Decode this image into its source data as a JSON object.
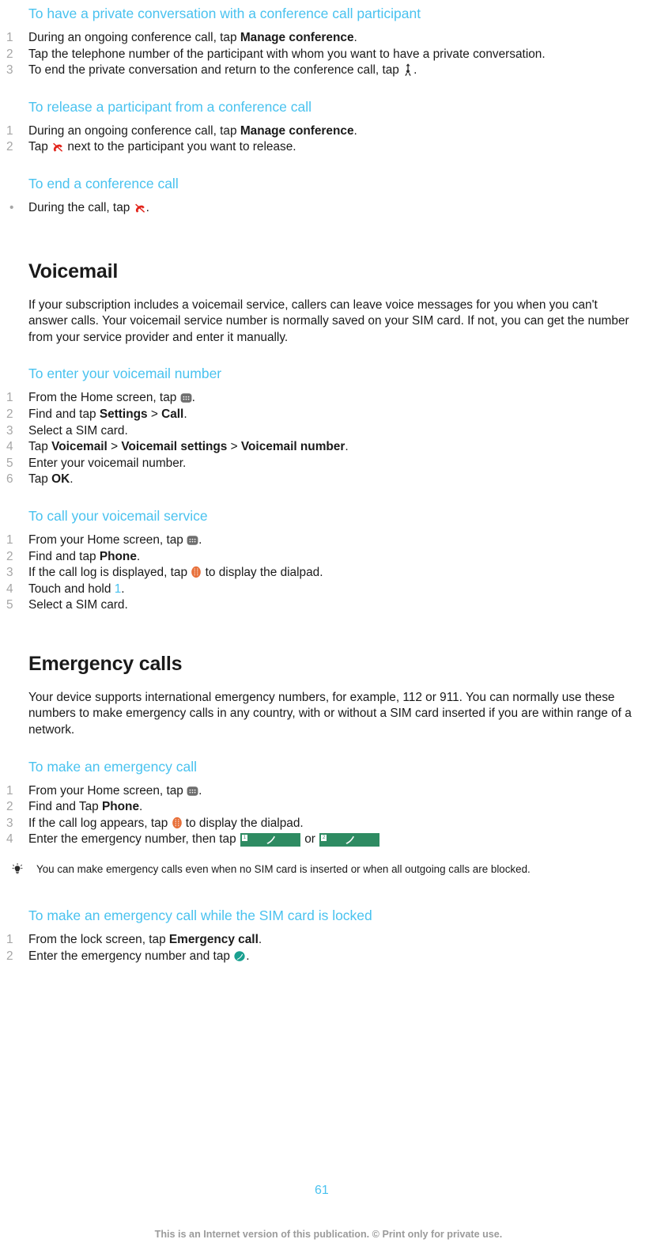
{
  "page": {
    "number": "61",
    "footer_note": "This is an Internet version of this publication. © Print only for private use."
  },
  "sections": [
    {
      "heading": "To have a private conversation with a conference call participant",
      "steps": [
        {
          "num": "1",
          "pre": "During an ongoing conference call, tap ",
          "bold": "Manage conference",
          "post": "."
        },
        {
          "num": "2",
          "pre": "Tap the telephone number of the participant with whom you want to have a private conversation.",
          "bold": "",
          "post": ""
        },
        {
          "num": "3",
          "pre": "To end the private conversation and return to the conference call, tap ",
          "bold": "",
          "post": ".",
          "icon": "conference-person-icon"
        }
      ]
    },
    {
      "heading": "To release a participant from a conference call",
      "steps": [
        {
          "num": "1",
          "pre": "During an ongoing conference call, tap ",
          "bold": "Manage conference",
          "post": "."
        },
        {
          "num": "2",
          "pre": "Tap ",
          "bold": "",
          "post": " next to the participant you want to release.",
          "icon": "end-call-icon"
        }
      ]
    },
    {
      "heading": "To end a conference call",
      "steps": [
        {
          "num": "•",
          "pre": "During the call, tap ",
          "bold": "",
          "post": ".",
          "icon": "end-call-icon"
        }
      ]
    }
  ],
  "voicemail": {
    "title": "Voicemail",
    "intro": "If your subscription includes a voicemail service, callers can leave voice messages for you when you can't answer calls. Your voicemail service number is normally saved on your SIM card. If not, you can get the number from your service provider and enter it manually.",
    "enter_number": {
      "heading": "To enter your voicemail number",
      "steps": [
        {
          "num": "1",
          "text_before": "From the Home screen, tap ",
          "icon": "app-drawer-icon",
          "text_after": "."
        },
        {
          "num": "2",
          "text_before": "Find and tap ",
          "bold1": "Settings",
          "sep1": " > ",
          "bold2": "Call",
          "text_after": "."
        },
        {
          "num": "3",
          "text_before": "Select a SIM card.",
          "text_after": ""
        },
        {
          "num": "4",
          "text_before": "Tap ",
          "bold1": "Voicemail",
          "sep1": " > ",
          "bold2": "Voicemail settings",
          "sep2": " > ",
          "bold3": "Voicemail number",
          "text_after": "."
        },
        {
          "num": "5",
          "text_before": "Enter your voicemail number.",
          "text_after": ""
        },
        {
          "num": "6",
          "text_before": "Tap ",
          "bold1": "OK",
          "text_after": "."
        }
      ]
    },
    "call_service": {
      "heading": "To call your voicemail service",
      "steps": [
        {
          "num": "1",
          "text_before": "From your Home screen, tap ",
          "icon": "app-drawer-icon",
          "text_after": "."
        },
        {
          "num": "2",
          "text_before": "Find and tap ",
          "bold1": "Phone",
          "text_after": "."
        },
        {
          "num": "3",
          "text_before": "If the call log is displayed, tap ",
          "icon": "dialpad-icon",
          "text_after": " to display the dialpad."
        },
        {
          "num": "4",
          "text_before": "Touch and hold ",
          "linknum": "1",
          "text_after": "."
        },
        {
          "num": "5",
          "text_before": "Select a SIM card.",
          "text_after": ""
        }
      ]
    }
  },
  "emergency": {
    "title": "Emergency calls",
    "intro": "Your device supports international emergency numbers, for example, 112 or 911. You can normally use these numbers to make emergency calls in any country, with or without a SIM card inserted if you are within range of a network.",
    "make_call": {
      "heading": "To make an emergency call",
      "steps": [
        {
          "num": "1",
          "text_before": "From your Home screen, tap ",
          "icon": "app-drawer-icon",
          "text_after": "."
        },
        {
          "num": "2",
          "text_before": "Find and Tap ",
          "bold1": "Phone",
          "text_after": "."
        },
        {
          "num": "3",
          "text_before": "If the call log appears, tap ",
          "icon": "dialpad-icon",
          "text_after": " to display the dialpad."
        },
        {
          "num": "4",
          "text_before": "Enter the emergency number, then tap ",
          "btn1": "1",
          "middle": " or ",
          "btn2": "2",
          "text_after": ""
        }
      ]
    },
    "tip": "You can make emergency calls even when no SIM card is inserted or when all outgoing calls are blocked.",
    "sim_locked": {
      "heading": "To make an emergency call while the SIM card is locked",
      "steps": [
        {
          "num": "1",
          "text_before": "From the lock screen, tap ",
          "bold1": "Emergency call",
          "text_after": "."
        },
        {
          "num": "2",
          "text_before": "Enter the emergency number and tap ",
          "icon": "teal-call-icon",
          "text_after": "."
        }
      ]
    }
  },
  "colors": {
    "heading_blue": "#49c2ef",
    "text_black": "#1a1a1a",
    "number_grey": "#a6a6a6",
    "end_call_red": "#e2231a",
    "dialpad_orange": "#e8703a",
    "app_drawer_grey": "#6e6e6e",
    "call_green": "#2e8b62",
    "teal_call": "#1aa090",
    "footer_grey": "#9b9b9b"
  }
}
